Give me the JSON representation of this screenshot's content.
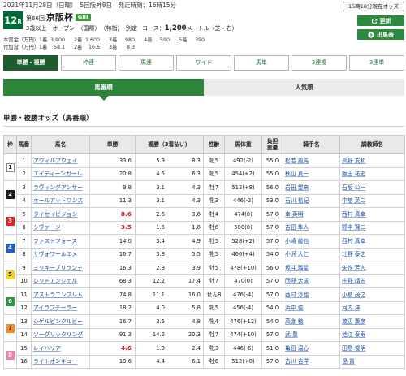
{
  "header": {
    "date_line": "2021年11月28日（日曜）　5回阪神8日　発走時刻：16時15分",
    "odds_time": "15時18分現在オッズ",
    "race_no": "12",
    "race_no_suffix": "R",
    "race_edition": "第66回",
    "race_name": "京阪杯",
    "grade": "GIII",
    "conditions": "3歳以上　オープン　（国際）　（特指）　別定",
    "course_label": "コース：",
    "course_distance": "1,200",
    "course_unit": "メートル（芝・右）",
    "refresh_label": "更新",
    "entries_label": "出馬表"
  },
  "icons": {
    "refresh": "refresh-icon",
    "entries": "circle-arrow-icon"
  },
  "prizes": [
    {
      "label": "本賞金（万円）",
      "items": [
        {
          "place": "1着",
          "amount": "3,900"
        },
        {
          "place": "2着",
          "amount": "1,600"
        },
        {
          "place": "3着",
          "amount": "980"
        },
        {
          "place": "4着",
          "amount": "590"
        },
        {
          "place": "5着",
          "amount": "390"
        }
      ]
    },
    {
      "label": "付加賞（万円）",
      "items": [
        {
          "place": "1着",
          "amount": "58.1"
        },
        {
          "place": "2着",
          "amount": "16.6"
        },
        {
          "place": "3着",
          "amount": "8.3"
        }
      ]
    }
  ],
  "bet_tabs": [
    {
      "label": "単勝・複勝",
      "active": true
    },
    {
      "label": "枠連",
      "active": false
    },
    {
      "label": "馬連",
      "active": false
    },
    {
      "label": "ワイド",
      "active": false
    },
    {
      "label": "馬単",
      "active": false
    },
    {
      "label": "3連複",
      "active": false
    },
    {
      "label": "3連単",
      "active": false
    }
  ],
  "sort_tabs": [
    {
      "label": "馬番順",
      "active": true
    },
    {
      "label": "人気順",
      "active": false
    }
  ],
  "section_title": "単勝・複勝オッズ（馬番順）",
  "table": {
    "columns": {
      "waku": "枠",
      "umaban": "馬番",
      "name": "馬名",
      "win": "単勝",
      "place": "複勝（3着払い）",
      "sex_age": "性齢",
      "weight": "馬体重",
      "burden_line1": "負担",
      "burden_line2": "重量",
      "jockey": "騎手名",
      "trainer": "調教師名"
    },
    "frames": [
      {
        "no": "1",
        "bg": "#ffffff",
        "fg": "#222222",
        "border": "#888888",
        "horses": [
          {
            "umaban": "1",
            "name": "アウィルアウェイ",
            "win": "33.6",
            "popular_top3": false,
            "place_min": "5.9",
            "place_max": "8.3",
            "sex_age": "牝5",
            "weight": "492(-2)",
            "burden": "55.0",
            "jockey": "松若 風馬",
            "trainer": "高野 友和"
          },
          {
            "umaban": "2",
            "name": "エイティーンガール",
            "win": "20.8",
            "popular_top3": false,
            "place_min": "4.5",
            "place_max": "6.3",
            "sex_age": "牝5",
            "weight": "454(+2)",
            "burden": "55.0",
            "jockey": "秋山 真一",
            "trainer": "飯田 祐史"
          }
        ]
      },
      {
        "no": "2",
        "bg": "#1a1a1a",
        "fg": "#ffffff",
        "horses": [
          {
            "umaban": "3",
            "name": "ラヴィングアンサー",
            "win": "9.8",
            "popular_top3": false,
            "place_min": "3.1",
            "place_max": "4.3",
            "sex_age": "牡7",
            "weight": "512(+8)",
            "burden": "56.0",
            "jockey": "岩田 望来",
            "trainer": "石坂 公一"
          },
          {
            "umaban": "4",
            "name": "オールアットワンス",
            "win": "11.3",
            "popular_top3": false,
            "place_min": "3.1",
            "place_max": "4.3",
            "sex_age": "牝3",
            "weight": "446(-2)",
            "burden": "53.0",
            "jockey": "石川 裕紀",
            "trainer": "中舘 英二"
          }
        ]
      },
      {
        "no": "3",
        "bg": "#e3232b",
        "fg": "#ffffff",
        "horses": [
          {
            "umaban": "5",
            "name": "タイセイビジョン",
            "win": "8.6",
            "popular_top3": true,
            "place_min": "2.6",
            "place_max": "3.6",
            "sex_age": "牡4",
            "weight": "474(0)",
            "burden": "57.0",
            "jockey": "幸 英明",
            "trainer": "西村 真幸"
          },
          {
            "umaban": "6",
            "name": "シヴァージ",
            "win": "3.5",
            "popular_top3": true,
            "place_min": "1.5",
            "place_max": "1.8",
            "sex_age": "牡6",
            "weight": "500(0)",
            "burden": "57.0",
            "jockey": "吉田 隼人",
            "trainer": "野中 賢二"
          }
        ]
      },
      {
        "no": "4",
        "bg": "#1c5fd1",
        "fg": "#ffffff",
        "horses": [
          {
            "umaban": "7",
            "name": "ファストフォース",
            "win": "14.0",
            "popular_top3": false,
            "place_min": "3.4",
            "place_max": "4.9",
            "sex_age": "牡5",
            "weight": "528(+2)",
            "burden": "57.0",
            "jockey": "小崎 綾也",
            "trainer": "西村 真幸"
          },
          {
            "umaban": "8",
            "name": "サヴォワールエメ",
            "win": "16.7",
            "popular_top3": false,
            "place_min": "3.8",
            "place_max": "5.5",
            "sex_age": "牝5",
            "weight": "466(+4)",
            "burden": "54.0",
            "jockey": "小沢 大仁",
            "trainer": "辻野 泰之"
          }
        ]
      },
      {
        "no": "5",
        "bg": "#f5d321",
        "fg": "#222222",
        "horses": [
          {
            "umaban": "9",
            "name": "ミッキーブリランテ",
            "win": "16.3",
            "popular_top3": false,
            "place_min": "2.8",
            "place_max": "3.9",
            "sex_age": "牡5",
            "weight": "478(+10)",
            "burden": "56.0",
            "jockey": "坂井 瑠星",
            "trainer": "矢作 芳人"
          },
          {
            "umaban": "10",
            "name": "レッドアンシェル",
            "win": "68.3",
            "popular_top3": false,
            "place_min": "12.2",
            "place_max": "17.4",
            "sex_age": "牡7",
            "weight": "470(0)",
            "burden": "57.0",
            "jockey": "団野 大成",
            "trainer": "庄野 靖志"
          }
        ]
      },
      {
        "no": "6",
        "bg": "#229a3f",
        "fg": "#ffffff",
        "horses": [
          {
            "umaban": "11",
            "name": "アストラエンブレム",
            "win": "74.8",
            "popular_top3": false,
            "place_min": "11.1",
            "place_max": "16.0",
            "sex_age": "せん8",
            "weight": "476(-4)",
            "burden": "57.0",
            "jockey": "西村 淳也",
            "trainer": "小島 茂之"
          },
          {
            "umaban": "12",
            "name": "アイラブテーラー",
            "win": "18.2",
            "popular_top3": false,
            "place_min": "4.0",
            "place_max": "5.8",
            "sex_age": "牝5",
            "weight": "456(-4)",
            "burden": "54.0",
            "jockey": "浜中 俊",
            "trainer": "河内 洋"
          }
        ]
      },
      {
        "no": "7",
        "bg": "#f28c22",
        "fg": "#222222",
        "horses": [
          {
            "umaban": "13",
            "name": "シゲルピンクルビー",
            "win": "16.7",
            "popular_top3": false,
            "place_min": "3.5",
            "place_max": "4.8",
            "sex_age": "牝4",
            "weight": "476(+12)",
            "burden": "54.0",
            "jockey": "高倉 稜",
            "trainer": "渡辺 薫彦"
          },
          {
            "umaban": "14",
            "name": "ソーグリッタリング",
            "win": "91.3",
            "popular_top3": false,
            "place_min": "14.2",
            "place_max": "20.3",
            "sex_age": "牡7",
            "weight": "474(+10)",
            "burden": "57.0",
            "jockey": "武 豊",
            "trainer": "池江 泰寿"
          }
        ]
      },
      {
        "no": "8",
        "bg": "#f27fae",
        "fg": "#ffffff",
        "horses": [
          {
            "umaban": "15",
            "name": "レイハリア",
            "win": "4.6",
            "popular_top3": true,
            "place_min": "1.9",
            "place_max": "2.4",
            "sex_age": "牝3",
            "weight": "446(-6)",
            "burden": "51.0",
            "jockey": "亀田 温心",
            "trainer": "田島 俊明"
          },
          {
            "umaban": "16",
            "name": "ライトオンキュー",
            "win": "19.6",
            "popular_top3": false,
            "place_min": "4.4",
            "place_max": "6.1",
            "sex_age": "牡6",
            "weight": "512(+8)",
            "burden": "57.0",
            "jockey": "古川 吉洋",
            "trainer": "昆 貢"
          }
        ]
      }
    ]
  },
  "colors": {
    "race_box": "#00693a",
    "grade_badge": "#3c9a3c",
    "button": "#2b8a3e",
    "tab_active": "#1e5c2f",
    "sort_active": "#2c853a",
    "link": "#1a49a0",
    "hot_odds": "#e0101a"
  }
}
